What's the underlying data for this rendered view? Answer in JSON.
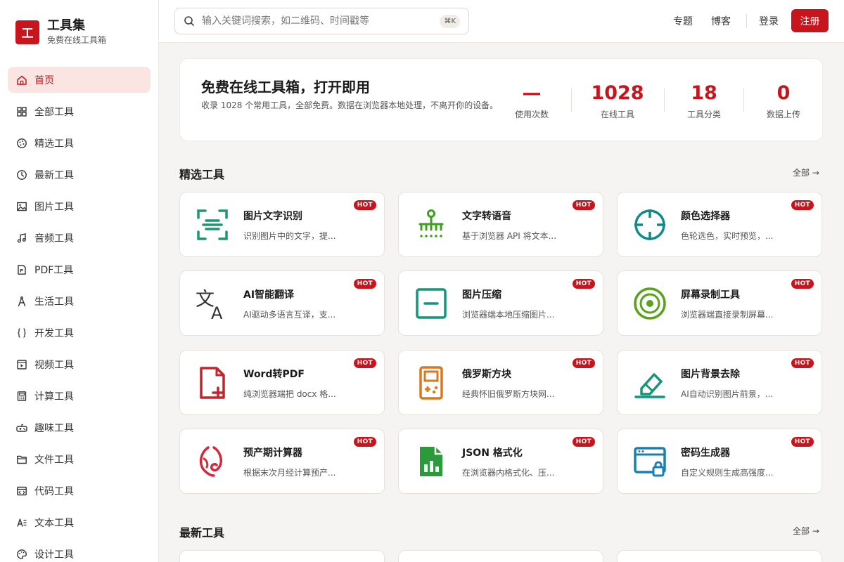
{
  "brand": {
    "logo_char": "工",
    "title": "工具集",
    "subtitle": "免费在线工具箱"
  },
  "nav": [
    {
      "label": "首页",
      "icon": "home-icon",
      "active": true
    },
    {
      "label": "全部工具",
      "icon": "grid-icon"
    },
    {
      "label": "精选工具",
      "icon": "palette-icon"
    },
    {
      "label": "最新工具",
      "icon": "clock-icon"
    },
    {
      "label": "图片工具",
      "icon": "image-icon"
    },
    {
      "label": "音频工具",
      "icon": "music-icon"
    },
    {
      "label": "PDF工具",
      "icon": "pdf-icon"
    },
    {
      "label": "生活工具",
      "icon": "compass-icon"
    },
    {
      "label": "开发工具",
      "icon": "braces-icon"
    },
    {
      "label": "视频工具",
      "icon": "video-icon"
    },
    {
      "label": "计算工具",
      "icon": "calculator-icon"
    },
    {
      "label": "趣味工具",
      "icon": "gamepad-icon"
    },
    {
      "label": "文件工具",
      "icon": "folder-icon"
    },
    {
      "label": "代码工具",
      "icon": "code-window-icon"
    },
    {
      "label": "文本工具",
      "icon": "text-icon"
    },
    {
      "label": "设计工具",
      "icon": "design-palette-icon"
    }
  ],
  "header": {
    "search_placeholder": "输入关键词搜索，如二维码、时间戳等",
    "shortcut": "⌘K",
    "links": {
      "topics": "专题",
      "blog": "博客",
      "login": "登录",
      "register": "注册"
    }
  },
  "hero": {
    "title": "免费在线工具箱，打开即用",
    "desc": "收录 1028 个常用工具，全部免费。数据在浏览器本地处理，不离开你的设备。",
    "stats": [
      {
        "value": "—",
        "label": "使用次数"
      },
      {
        "value": "1028",
        "label": "在线工具"
      },
      {
        "value": "18",
        "label": "工具分类"
      },
      {
        "value": "0",
        "label": "数据上传"
      }
    ]
  },
  "sections": {
    "featured": {
      "title": "精选工具",
      "more": "全部 →"
    },
    "latest": {
      "title": "最新工具",
      "more": "全部 →"
    }
  },
  "hot_label": "HOT",
  "featured_tools": [
    {
      "title": "图片文字识别",
      "desc": "识别图片中的文字，提...",
      "icon": "scan-text-icon",
      "color": "#1a9a6c"
    },
    {
      "title": "文字转语音",
      "desc": "基于浏览器 API 将文本...",
      "icon": "speech-tree-icon",
      "color": "#3fa020"
    },
    {
      "title": "颜色选择器",
      "desc": "色轮选色，实时预览，...",
      "icon": "crosshair-icon",
      "color": "#138a8a"
    },
    {
      "title": "AI智能翻译",
      "desc": "AI驱动多语言互译，支...",
      "icon": "translate-icon",
      "color": "#333333"
    },
    {
      "title": "图片压缩",
      "desc": "浏览器端本地压缩图片...",
      "icon": "compress-icon",
      "color": "#15967a"
    },
    {
      "title": "屏幕录制工具",
      "desc": "浏览器端直接录制屏幕...",
      "icon": "disc-icon",
      "color": "#5aa21e"
    },
    {
      "title": "Word转PDF",
      "desc": "纯浏览器端把 docx 格...",
      "icon": "file-plus-icon",
      "color": "#c0262c"
    },
    {
      "title": "俄罗斯方块",
      "desc": "经典怀旧俄罗斯方块网...",
      "icon": "gameboy-icon",
      "color": "#d9791c"
    },
    {
      "title": "图片背景去除",
      "desc": "AI自动识别图片前景，...",
      "icon": "eraser-icon",
      "color": "#15967a"
    },
    {
      "title": "预产期计算器",
      "desc": "根据末次月经计算预产...",
      "icon": "pregnancy-icon",
      "color": "#d4283c"
    },
    {
      "title": "JSON 格式化",
      "desc": "在浏览器内格式化、压...",
      "icon": "file-chart-icon",
      "color": "#2a9a3a"
    },
    {
      "title": "密码生成器",
      "desc": "自定义规则生成高强度...",
      "icon": "window-lock-icon",
      "color": "#1d7fb0"
    }
  ],
  "colors": {
    "accent": "#c8141c",
    "active_bg": "#fbe5e3"
  }
}
